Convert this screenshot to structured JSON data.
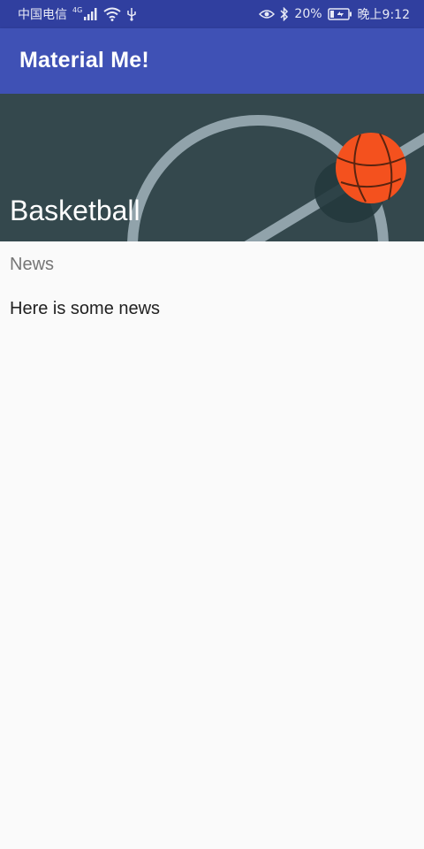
{
  "status_bar": {
    "carrier": "中国电信",
    "network_type": "4G",
    "battery_percent": "20%",
    "time": "晚上9:12",
    "icons": [
      "signal-icon",
      "wifi-icon",
      "usb-icon",
      "eye-icon",
      "bluetooth-icon",
      "battery-icon"
    ]
  },
  "app_bar": {
    "title": "Material Me!"
  },
  "detail": {
    "banner_title": "Basketball",
    "subtitle": "News",
    "body": "Here is some news"
  },
  "colors": {
    "primary": "#3f51b5",
    "primary_dark": "#303f9f",
    "banner_bg": "#34484d",
    "ball": "#f4511e",
    "background": "#fafafa"
  }
}
